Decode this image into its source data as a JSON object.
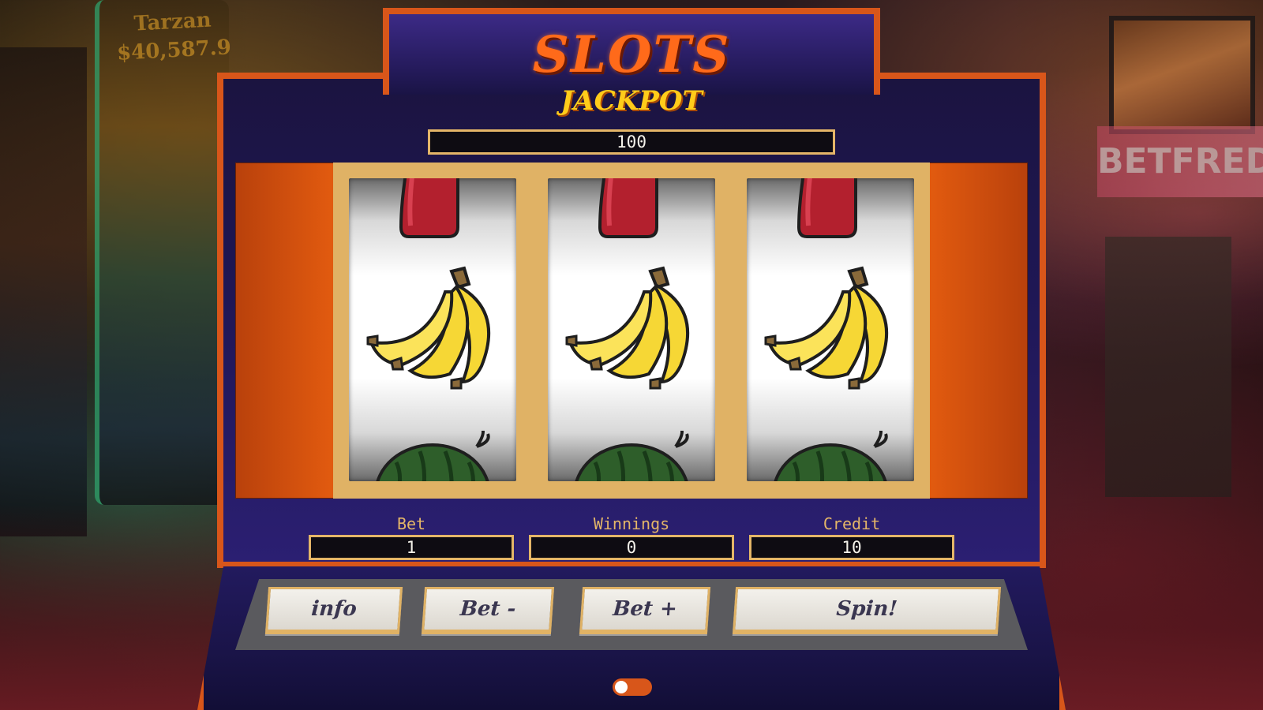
{
  "game": {
    "title": "SLOTS",
    "jackpot_label": "JACKPOT",
    "jackpot_value": "100"
  },
  "reels": [
    {
      "top": "cherry",
      "middle": "banana",
      "bottom": "watermelon"
    },
    {
      "top": "cherry",
      "middle": "banana",
      "bottom": "watermelon"
    },
    {
      "top": "cherry",
      "middle": "banana",
      "bottom": "watermelon"
    }
  ],
  "stats": {
    "bet_label": "Bet",
    "bet_value": "1",
    "winnings_label": "Winnings",
    "winnings_value": "0",
    "credit_label": "Credit",
    "credit_value": "10"
  },
  "controls": {
    "info_label": "info",
    "bet_minus_label": "Bet -",
    "bet_plus_label": "Bet +",
    "spin_label": "Spin!",
    "sound_toggle_on": false
  },
  "background": {
    "sign_left": "Tarzan $40,587.9",
    "sign_right": "BETFRED"
  },
  "colors": {
    "accent_orange": "#d8561a",
    "gold": "#e0b265",
    "title": "#ff6a1a",
    "jackpot": "#ffcc1a",
    "machine_blue": "#1f1755"
  }
}
